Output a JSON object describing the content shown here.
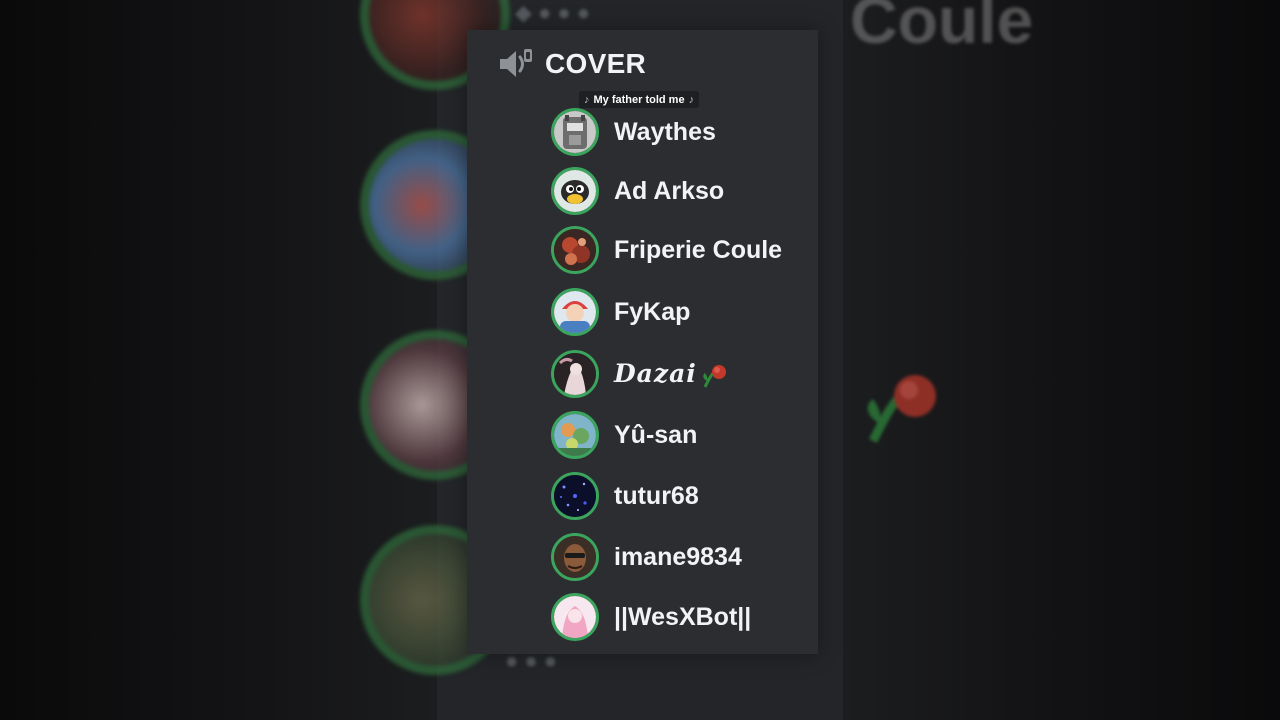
{
  "channel": {
    "name": "COVER",
    "icon": "speaker-icon",
    "activity": {
      "note_symbol": "♪",
      "text": "My father told me"
    }
  },
  "members": [
    {
      "name": "Waythes",
      "avatar": "avatar-waythes"
    },
    {
      "name": "Ad Arkso",
      "avatar": "avatar-ad-arkso"
    },
    {
      "name": "Friperie Coule",
      "avatar": "avatar-friperie-coule"
    },
    {
      "name": "FyKap",
      "avatar": "avatar-fykap"
    },
    {
      "name": "Dazai",
      "avatar": "avatar-dazai",
      "decoration": "rose-icon"
    },
    {
      "name": "Yû-san",
      "avatar": "avatar-yu-san"
    },
    {
      "name": "tutur68",
      "avatar": "avatar-tutur68"
    },
    {
      "name": "imane9834",
      "avatar": "avatar-imane9834"
    },
    {
      "name": "||WesXBot||",
      "avatar": "avatar-wesxbot"
    }
  ],
  "background": {
    "zoomed_text": "Coule"
  },
  "colors": {
    "panel_bg": "#2b2d31",
    "speaking_ring": "#3ba55d",
    "text": "#f2f3f5"
  }
}
